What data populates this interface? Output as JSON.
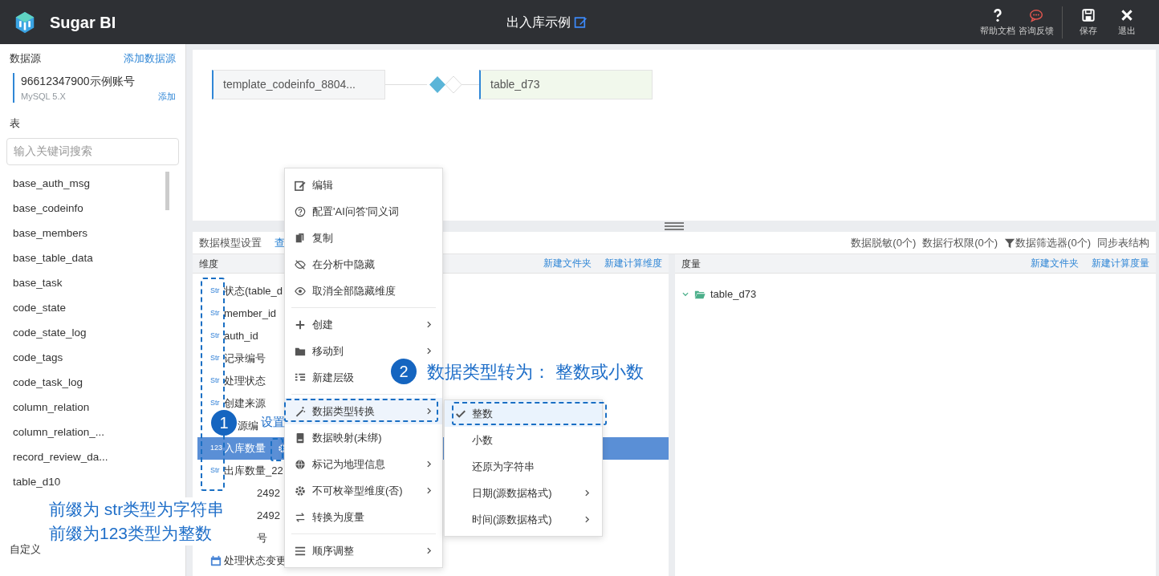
{
  "header": {
    "app_name": "Sugar BI",
    "title": "出入库示例",
    "action_groups": [
      [
        {
          "label": "帮助文档",
          "kind": "help"
        },
        {
          "label": "咨询反馈",
          "kind": "chat"
        }
      ],
      [
        {
          "label": "保存",
          "kind": "save"
        },
        {
          "label": "退出",
          "kind": "exit"
        }
      ]
    ]
  },
  "sidebar": {
    "datasource_heading": "数据源",
    "add_datasource": "添加数据源",
    "account": {
      "name": "96612347900示例账号",
      "type": "MySQL 5.X",
      "add": "添加"
    },
    "tables_heading": "表",
    "search": {
      "placeholder": "输入关键词搜索"
    },
    "tables": [
      "base_auth_msg",
      "base_codeinfo",
      "base_members",
      "base_table_data",
      "base_task",
      "code_state",
      "code_state_log",
      "code_tags",
      "code_task_log",
      "column_relation",
      "column_relation_...",
      "record_review_da...",
      "table_d10"
    ],
    "custom_heading": "自定义"
  },
  "canvas": {
    "nodes": [
      {
        "label": "template_codeinfo_8804...",
        "kind": "source"
      },
      {
        "label": "table_d73",
        "kind": "target"
      }
    ]
  },
  "model_bar": {
    "title": "数据模型设置",
    "link": "查",
    "actions": [
      {
        "label": "数据脱敏(0个)",
        "kind": "text"
      },
      {
        "label": "数据行权限(0个)",
        "kind": "text"
      },
      {
        "label": "数据筛选器(0个)",
        "kind": "filter"
      },
      {
        "label": "同步表结构",
        "kind": "text"
      }
    ]
  },
  "dimensions": {
    "heading": "维度",
    "actions": [
      "新建文件夹",
      "新建计算维度"
    ],
    "rows": [
      {
        "kind": "field",
        "type": "Str",
        "name": "状态(table_d",
        "selected": false
      },
      {
        "kind": "field",
        "type": "Str",
        "name": "member_id",
        "selected": false
      },
      {
        "kind": "field",
        "type": "Str",
        "name": "auth_id",
        "selected": false
      },
      {
        "kind": "field",
        "type": "Str",
        "name": "记录编号",
        "selected": false
      },
      {
        "kind": "field",
        "type": "Str",
        "name": "处理状态",
        "selected": false
      },
      {
        "kind": "field",
        "type": "Str",
        "name": "创建来源",
        "selected": false
      },
      {
        "kind": "plain",
        "name": "源编",
        "selected": false
      },
      {
        "kind": "field",
        "type": "123",
        "name": "入库数量",
        "selected": true
      },
      {
        "kind": "field",
        "type": "Str",
        "name": "出库数量_22",
        "selected": false
      },
      {
        "kind": "covered",
        "name": "2492",
        "selected": false
      },
      {
        "kind": "covered",
        "name": "2492",
        "selected": false
      },
      {
        "kind": "covered",
        "name": "号",
        "selected": false
      },
      {
        "kind": "date",
        "name": "处理状态变更",
        "selected": false
      }
    ]
  },
  "measures": {
    "heading": "度量",
    "actions": [
      "新建文件夹",
      "新建计算度量"
    ],
    "tree": [
      {
        "label": "table_d73",
        "expanded": true
      }
    ]
  },
  "context_menu": {
    "groups": [
      [
        {
          "label": "编辑",
          "submenu": false,
          "highlighted": false
        },
        {
          "label": "配置'AI问答'同义词",
          "submenu": false,
          "highlighted": false
        },
        {
          "label": "复制",
          "submenu": false,
          "highlighted": false
        },
        {
          "label": "在分析中隐藏",
          "submenu": false,
          "highlighted": false
        },
        {
          "label": "取消全部隐藏维度",
          "submenu": false,
          "highlighted": false
        }
      ],
      [
        {
          "label": "创建",
          "submenu": true,
          "highlighted": false
        },
        {
          "label": "移动到",
          "submenu": true,
          "highlighted": false
        },
        {
          "label": "新建层级",
          "submenu": false,
          "highlighted": false
        }
      ],
      [
        {
          "label": "数据类型转换",
          "submenu": true,
          "highlighted": true
        },
        {
          "label": "数据映射(未绑)",
          "submenu": false,
          "highlighted": false
        },
        {
          "label": "标记为地理信息",
          "submenu": true,
          "highlighted": false
        },
        {
          "label": "不可枚举型维度(否)",
          "submenu": true,
          "highlighted": false
        },
        {
          "label": "转换为度量",
          "submenu": false,
          "highlighted": false
        }
      ],
      [
        {
          "label": "顺序调整",
          "submenu": true,
          "highlighted": false
        }
      ]
    ]
  },
  "submenu": {
    "items": [
      {
        "label": "整数",
        "selected": true,
        "submenu": false
      },
      {
        "label": "小数",
        "selected": false,
        "submenu": false
      },
      {
        "label": "还原为字符串",
        "selected": false,
        "submenu": false
      },
      {
        "label": "日期(源数据格式)",
        "selected": false,
        "submenu": true
      },
      {
        "label": "时间(源数据格式)",
        "selected": false,
        "submenu": true
      }
    ]
  },
  "annotations": {
    "steps": [
      {
        "number": "1",
        "label": "设置"
      },
      {
        "number": "2",
        "label": "数据类型转为： 整数或小数"
      }
    ],
    "note": [
      "前缀为 str类型为字符串",
      "前缀为123类型为整数"
    ]
  }
}
